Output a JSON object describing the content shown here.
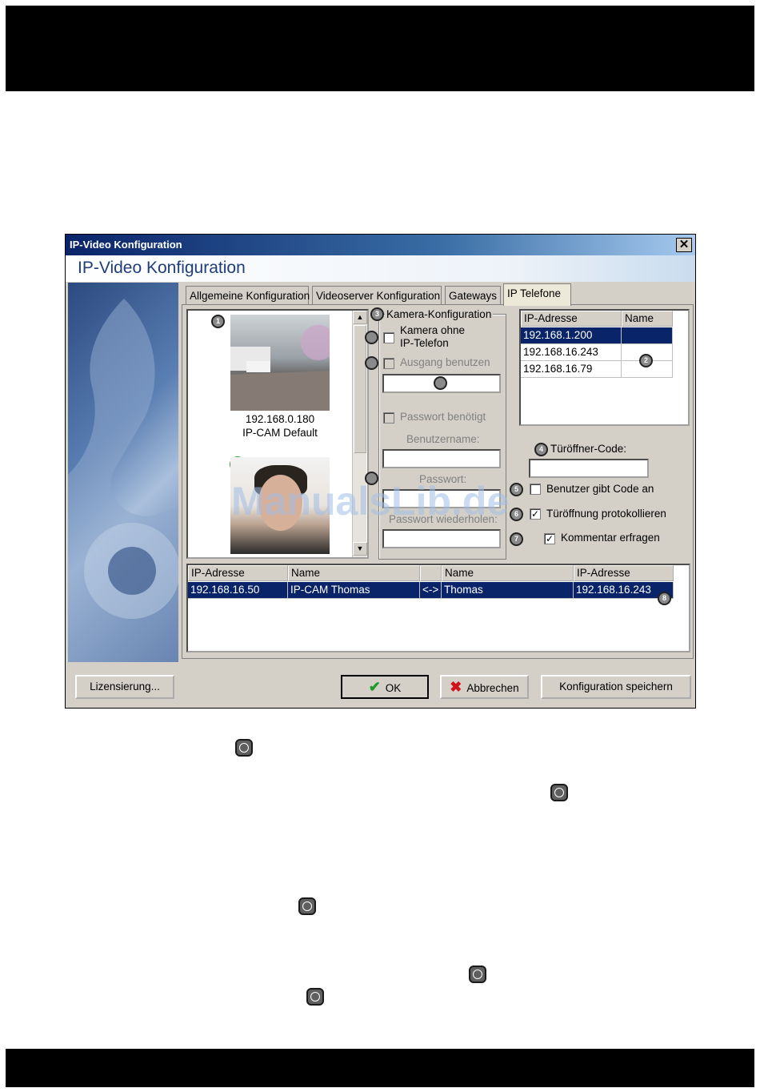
{
  "window": {
    "title": "IP-Video Konfiguration",
    "banner_title": "IP-Video Konfiguration",
    "close_glyph": "✕"
  },
  "tabs": [
    {
      "label": "Allgemeine Konfiguration"
    },
    {
      "label": "Videoserver Konfiguration"
    },
    {
      "label": "Gateways"
    },
    {
      "label": "IP Telefone",
      "active": true
    }
  ],
  "cameras": [
    {
      "ip": "192.168.0.180",
      "name": "IP-CAM Default"
    },
    {
      "check_glyph": "✔"
    }
  ],
  "camera_config": {
    "group_label": "Kamera-Konfiguration",
    "no_phone_label_1": "Kamera ohne",
    "no_phone_label_2": "IP-Telefon",
    "output_label": "Ausgang benutzen",
    "password_required_label": "Passwort benötigt",
    "username_label": "Benutzername:",
    "password_label": "Passwort:",
    "password_repeat_label": "Passwort wiederholen:"
  },
  "phones": {
    "columns": [
      "IP-Adresse",
      "Name"
    ],
    "rows": [
      {
        "ip": "192.168.1.200",
        "name": "",
        "selected": true
      },
      {
        "ip": "192.168.16.243",
        "name": ""
      },
      {
        "ip": "192.168.16.79",
        "name": ""
      }
    ]
  },
  "door": {
    "code_label": "Türöffner-Code:",
    "user_code_label": "Benutzer gibt Code an",
    "log_label": "Türöffnung protokollieren",
    "comment_label": "Kommentar erfragen",
    "user_code_checked": false,
    "log_checked": true,
    "comment_checked": true,
    "check_glyph": "✓"
  },
  "links": {
    "columns": [
      "IP-Adresse",
      "Name",
      "",
      "Name",
      "IP-Adresse"
    ],
    "rows": [
      {
        "cam_ip": "192.168.16.50",
        "cam_name": "IP-CAM Thomas",
        "arrow": "<->",
        "phone_name": "Thomas",
        "phone_ip": "192.168.16.243"
      }
    ]
  },
  "buttons": {
    "license": "Lizensierung...",
    "ok": "OK",
    "cancel": "Abbrechen",
    "save": "Konfiguration speichern",
    "ok_glyph": "✔",
    "cancel_glyph": "✖"
  },
  "scroll": {
    "up": "▲",
    "down": "▼"
  },
  "callouts": [
    "1",
    "2",
    "3",
    "4",
    "5",
    "6",
    "7",
    "8"
  ],
  "watermark": "ManualsLib.de"
}
